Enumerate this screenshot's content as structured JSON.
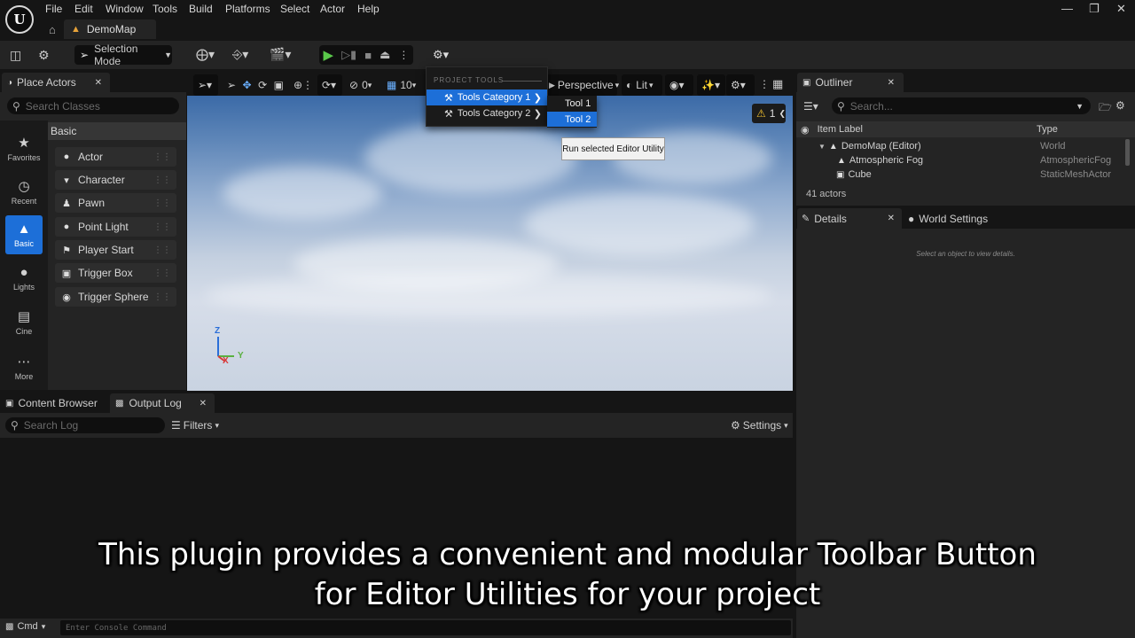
{
  "menubar": {
    "items": [
      "File",
      "Edit",
      "Window",
      "Tools",
      "Build",
      "Platforms",
      "Select",
      "Actor",
      "Help"
    ]
  },
  "doc_tab": {
    "name": "DemoMap"
  },
  "toolbar": {
    "selection_mode": "Selection Mode"
  },
  "place_actors": {
    "tab_label": "Place Actors",
    "search_placeholder": "Search Classes",
    "section": "Basic",
    "categories": [
      {
        "label": "Favorites",
        "icon": "star-icon"
      },
      {
        "label": "Recent",
        "icon": "clock-icon"
      },
      {
        "label": "Basic",
        "icon": "shapes-icon"
      },
      {
        "label": "Lights",
        "icon": "bulb-icon"
      },
      {
        "label": "Cine",
        "icon": "clapper-icon"
      },
      {
        "label": "More",
        "icon": "more-icon"
      }
    ],
    "actors": [
      "Actor",
      "Character",
      "Pawn",
      "Point Light",
      "Player Start",
      "Trigger Box",
      "Trigger Sphere"
    ]
  },
  "viewport": {
    "perspective": "Perspective",
    "lit": "Lit",
    "rotation_snap": "0",
    "grid_snap": "10",
    "warning_count": "1",
    "axis": {
      "z": "Z",
      "x": "X",
      "y": "Y"
    }
  },
  "tools_menu": {
    "header": "PROJECT TOOLS",
    "categories": [
      "Tools Category 1",
      "Tools Category 2"
    ],
    "sub_items": [
      "Tool 1",
      "Tool 2"
    ],
    "tooltip": "Run selected Editor Utility"
  },
  "outliner": {
    "tab_label": "Outliner",
    "search_placeholder": "Search...",
    "col_label": "Item Label",
    "col_type": "Type",
    "rows": [
      {
        "label": "DemoMap (Editor)",
        "type": "World"
      },
      {
        "label": "Atmospheric Fog",
        "type": "AtmosphericFog"
      },
      {
        "label": "Cube",
        "type": "StaticMeshActor"
      }
    ],
    "actor_count": "41 actors"
  },
  "details": {
    "tab_label": "Details",
    "world_settings": "World Settings",
    "empty_hint": "Select an object to view details."
  },
  "bottom": {
    "content_browser": "Content Browser",
    "output_log": "Output Log",
    "search_placeholder": "Search Log",
    "filters": "Filters",
    "settings": "Settings",
    "cmd": "Cmd",
    "console_placeholder": "Enter Console Command"
  },
  "caption": {
    "line1": "This plugin provides a convenient and modular Toolbar Button",
    "line2": "for Editor Utilities for your project"
  },
  "colors": {
    "accent": "#1d6fd8",
    "play_green": "#5ac84a",
    "warning": "#f2c12e"
  }
}
